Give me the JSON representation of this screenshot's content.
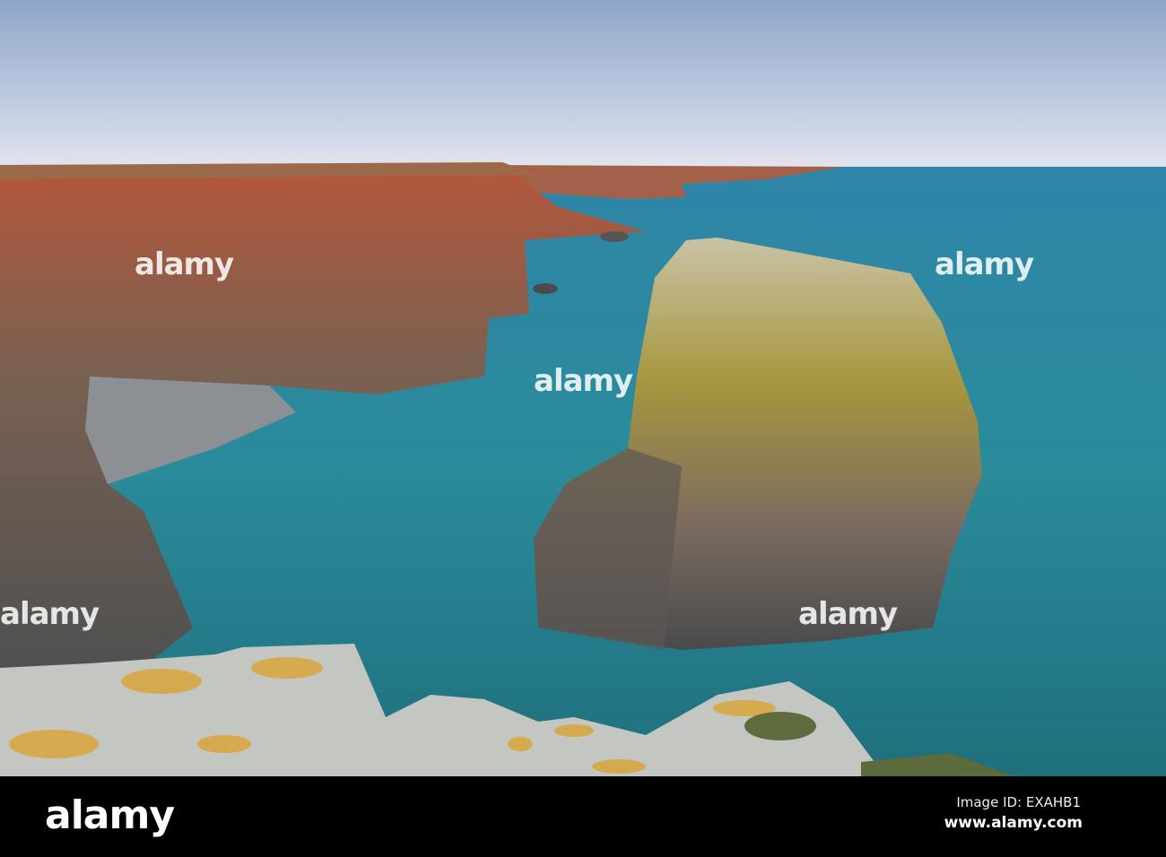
{
  "watermark": {
    "text": "alamy"
  },
  "footer": {
    "logo": "alamy",
    "image_id": "Image ID: EXAHB1",
    "url": "www.alamy.com"
  },
  "colors": {
    "sky_top": "#8da5c9",
    "sky_horizon": "#e2e5ee",
    "sea": "#2a8b9b",
    "lichen": "#d9a53a"
  }
}
